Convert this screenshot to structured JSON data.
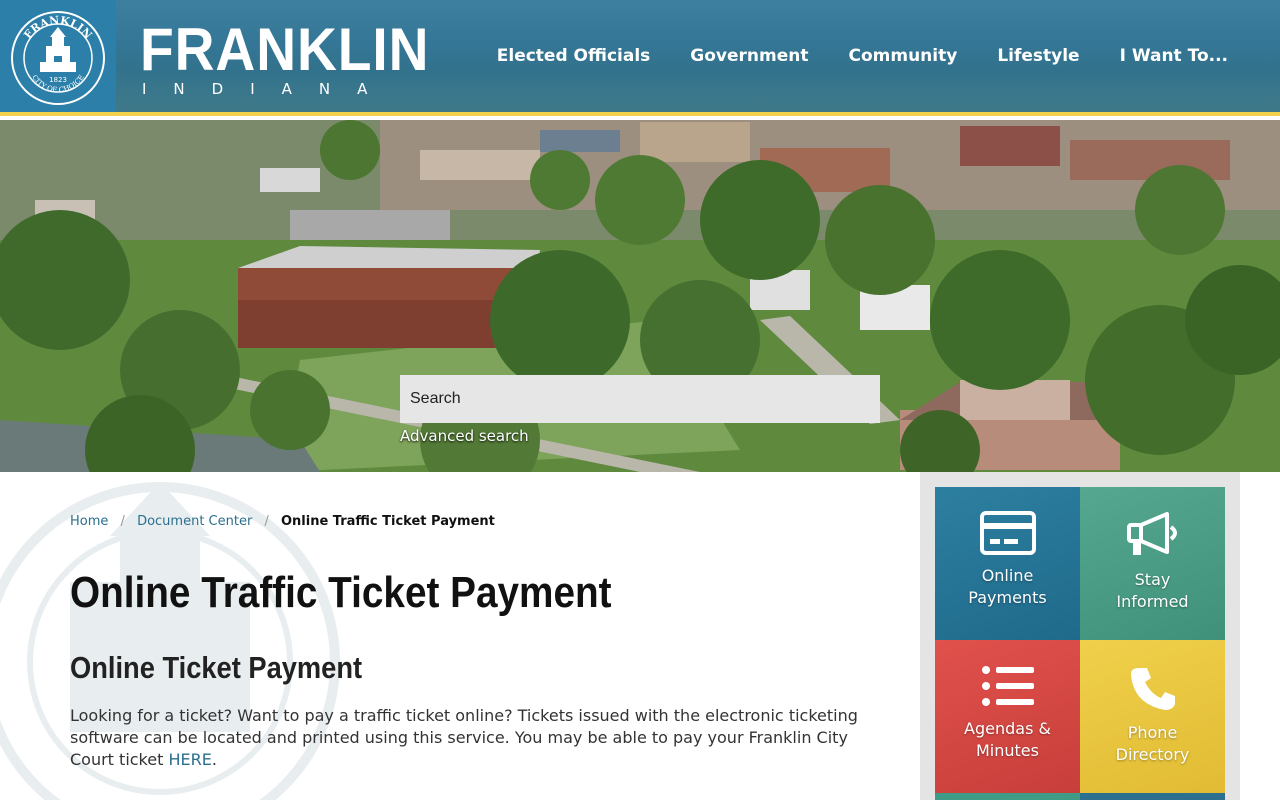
{
  "header": {
    "seal_text_top": "FRANKLIN",
    "seal_text_bottom": "CITY OF CHOICE",
    "seal_year": "1823",
    "logo_city": "FRANKLIN",
    "logo_state": "INDIANA",
    "nav": [
      "Elected Officials",
      "Government",
      "Community",
      "Lifestyle",
      "I Want To..."
    ]
  },
  "search": {
    "placeholder": "Search",
    "advanced_label": "Advanced search"
  },
  "breadcrumb": {
    "home": "Home",
    "document_center": "Document Center",
    "current": "Online Traffic Ticket Payment"
  },
  "page": {
    "title": "Online Traffic Ticket Payment",
    "subtitle": "Online Ticket Payment",
    "body_text": "Looking for a ticket? Want to pay a traffic ticket online? Tickets issued with the electronic ticketing software can be located and printed using this service. You may be able to pay your Franklin City Court ticket ",
    "body_link": "HERE",
    "body_end": "."
  },
  "tiles": [
    {
      "line1": "Online",
      "line2": "Payments",
      "icon": "credit-card-icon"
    },
    {
      "line1": "Stay",
      "line2": "Informed",
      "icon": "megaphone-icon"
    },
    {
      "line1": "Agendas &",
      "line2": "Minutes",
      "icon": "list-icon"
    },
    {
      "line1": "Phone",
      "line2": "Directory",
      "icon": "phone-icon"
    }
  ],
  "colors": {
    "header_blue": "#2f7190",
    "accent_yellow": "#f2d24c",
    "link_blue": "#2b6f8f",
    "tile_blue": "#2d7fa0",
    "tile_green": "#55a88f",
    "tile_red": "#e0514c",
    "tile_yellow": "#f0d04b"
  }
}
